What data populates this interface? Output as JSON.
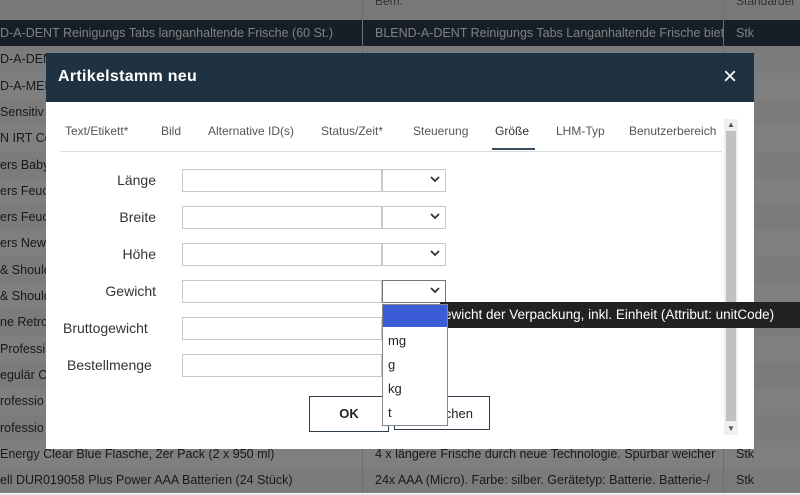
{
  "background_table": {
    "header": {
      "col1": "",
      "col2": "Bem.",
      "col3": "Standardei"
    },
    "rows": [
      {
        "c1": "D-A-DENT Reinigungs Tabs langanhaltende Frische (60 St.)",
        "c2": "BLEND-A-DENT Reinigungs Tabs Langanhaltende Frische biet",
        "c3": "Stk"
      },
      {
        "c1": "D-A-DENT",
        "c2": "",
        "c3": ""
      },
      {
        "c1": "D-A-MED",
        "c2": "",
        "c3": ""
      },
      {
        "c1": " Sensitiv",
        "c2": "",
        "c3": ""
      },
      {
        "c1": "N IRT Co",
        "c2": "",
        "c3": ""
      },
      {
        "c1": "ers Baby",
        "c2": "",
        "c3": ""
      },
      {
        "c1": "ers Feuc",
        "c2": "",
        "c3": ""
      },
      {
        "c1": "ers Feuc",
        "c2": "",
        "c3": ""
      },
      {
        "c1": "ers New",
        "c2": "",
        "c3": ""
      },
      {
        "c1": "& Should",
        "c2": "",
        "c3": ""
      },
      {
        "c1": "& Should",
        "c2": "",
        "c3": ""
      },
      {
        "c1": "ne Retro-",
        "c2": "",
        "c3": ""
      },
      {
        "c1": "Professi",
        "c2": "",
        "c3": ""
      },
      {
        "c1": "egulär C",
        "c2": "",
        "c3": ""
      },
      {
        "c1": "rofessio",
        "c2": "",
        "c3": ""
      },
      {
        "c1": "rofessio",
        "c2": "",
        "c3": ""
      },
      {
        "c1": "Energy Clear Blue Flasche, 2er Pack (2 x 950 ml)",
        "c2": "4 x längere Frische durch neue Technologie. Spürbar weicher",
        "c3": "Stk"
      },
      {
        "c1": "ell DUR019058 Plus Power AAA Batterien (24 Stück)",
        "c2": "24x AAA (Micro). Farbe: silber. Gerätetyp: Batterie. Batterie-/",
        "c3": "Stk"
      }
    ]
  },
  "modal": {
    "title": "Artikelstamm neu",
    "close": "×",
    "tabs": [
      "Text/Etikett*",
      "Bild",
      "Alternative ID(s)",
      "Status/Zeit*",
      "Steuerung",
      "Größe",
      "LHM-Typ",
      "Benutzerbereich"
    ],
    "active_tab": "Größe",
    "fields": [
      {
        "label": "Länge",
        "value": "",
        "unit": ""
      },
      {
        "label": "Breite",
        "value": "",
        "unit": ""
      },
      {
        "label": "Höhe",
        "value": "",
        "unit": ""
      },
      {
        "label": "Gewicht",
        "value": "",
        "unit": ""
      },
      {
        "label": "Bruttogewicht",
        "value": "",
        "unit": ""
      },
      {
        "label": "Bestellmenge",
        "value": "",
        "unit": ""
      }
    ],
    "ok_label": "OK",
    "cancel_label": "Abbrechen",
    "cancel_visible": "chen"
  },
  "dropdown": {
    "options": [
      "",
      "mg",
      "g",
      "kg",
      "t"
    ],
    "highlighted_index": 0,
    "highlight_color": "#3c5bd6"
  },
  "tooltip": {
    "text": "Gewicht der Verpackung, inkl. Einheit (Attribut: unitCode)",
    "visible_text": "ewicht der Verpackung, inkl. Einheit (Attribut: unitCode)"
  },
  "colors": {
    "header_bg": "#1f3242",
    "selected_row_bg": "#2d3e4f",
    "overlay": "rgba(0,0,0,0.5)"
  }
}
